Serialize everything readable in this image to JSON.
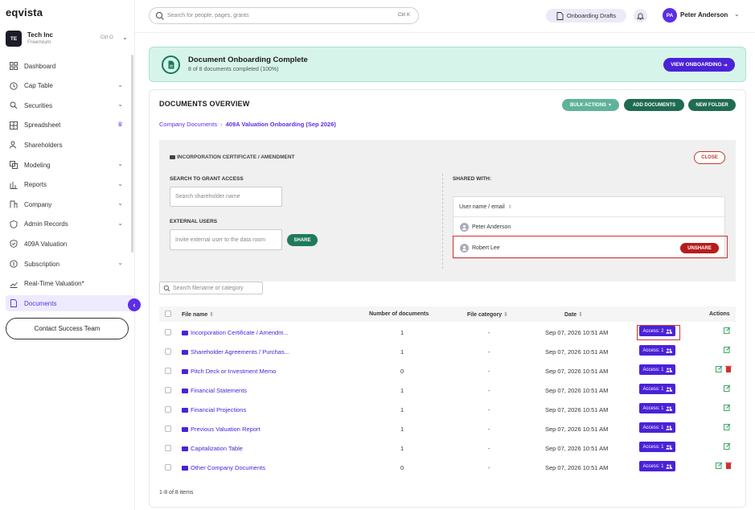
{
  "brand": {
    "logo": "eqvista",
    "accent": "#5b2ee8"
  },
  "org": {
    "initials": "TE",
    "name": "Tech Inc",
    "plan": "Freemium",
    "shortcut": "Ctrl O"
  },
  "sidebar": {
    "items": [
      {
        "label": "Dashboard",
        "icon": "dashboard-icon",
        "chevron": false
      },
      {
        "label": "Cap Table",
        "icon": "clock-icon",
        "chevron": true
      },
      {
        "label": "Securities",
        "icon": "securities-icon",
        "chevron": true
      },
      {
        "label": "Spreadsheet",
        "icon": "grid-icon",
        "chevron": false,
        "crown": true
      },
      {
        "label": "Shareholders",
        "icon": "users-icon",
        "chevron": false
      },
      {
        "label": "Modeling",
        "icon": "modeling-icon",
        "chevron": true
      },
      {
        "label": "Reports",
        "icon": "reports-icon",
        "chevron": true
      },
      {
        "label": "Company",
        "icon": "company-icon",
        "chevron": true
      },
      {
        "label": "Admin Records",
        "icon": "admin-icon",
        "chevron": true
      },
      {
        "label": "409A Valuation",
        "icon": "shield-icon",
        "chevron": false
      },
      {
        "label": "Subscription",
        "icon": "subscription-icon",
        "chevron": true
      },
      {
        "label": "Real-Time Valuation*",
        "icon": "chart-line-icon",
        "chevron": false
      },
      {
        "label": "Documents",
        "icon": "document-icon",
        "chevron": false,
        "active": true
      }
    ],
    "contact_label": "Contact Success Team"
  },
  "topbar": {
    "search_placeholder": "Search for people, pages, grants",
    "search_shortcut": "Ctrl K",
    "drafts_label": "Onboarding Drafts",
    "user_initials": "PA",
    "user_name": "Peter Anderson"
  },
  "banner": {
    "title": "Document Onboarding Complete",
    "subtitle": "8 of 8 documents completed (100%)",
    "button": "VIEW ONBOARDING"
  },
  "overview": {
    "title": "DOCUMENTS OVERVIEW",
    "bulk_actions": "BULK ACTIONS",
    "add_documents": "ADD DOCUMENTS",
    "new_folder": "NEW FOLDER",
    "breadcrumb_root": "Company Documents",
    "breadcrumb_current": "409A Valuation Onboarding (Sep 2026)"
  },
  "share_panel": {
    "folder_title": "INCORPORATION CERTIFICATE / AMENDMENT",
    "close": "CLOSE",
    "search_label": "SEARCH TO GRANT ACCESS",
    "search_placeholder": "Search shareholder name",
    "external_label": "EXTERNAL USERS",
    "external_placeholder": "Invite external user to the data room",
    "share_button": "SHARE",
    "shared_with_label": "SHARED WITH:",
    "column_header": "User name / email",
    "users": [
      "Peter Anderson",
      "Robert Lee"
    ],
    "unshare": "UNSHARE"
  },
  "table": {
    "filter_placeholder": "Search filename or category",
    "headers": {
      "file": "File name",
      "count": "Number of documents",
      "category": "File category",
      "date": "Date",
      "actions": "Actions"
    },
    "rows": [
      {
        "name": "Incorporation Certificate / Amendm...",
        "count": "1",
        "category": "-",
        "date": "Sep 07, 2026 10:51 AM",
        "access": "Access: 2",
        "delete": false
      },
      {
        "name": "Shareholder Agreements / Purchas...",
        "count": "1",
        "category": "-",
        "date": "Sep 07, 2026 10:51 AM",
        "access": "Access: 1",
        "delete": false
      },
      {
        "name": "Pitch Deck or Investment Memo",
        "count": "0",
        "category": "-",
        "date": "Sep 07, 2026 10:51 AM",
        "access": "Access: 1",
        "delete": true
      },
      {
        "name": "Financial Statements",
        "count": "1",
        "category": "-",
        "date": "Sep 07, 2026 10:51 AM",
        "access": "Access: 1",
        "delete": false
      },
      {
        "name": "Financial Projections",
        "count": "1",
        "category": "-",
        "date": "Sep 07, 2026 10:51 AM",
        "access": "Access: 1",
        "delete": false
      },
      {
        "name": "Previous Valuation Report",
        "count": "1",
        "category": "-",
        "date": "Sep 07, 2026 10:51 AM",
        "access": "Access: 1",
        "delete": false
      },
      {
        "name": "Capitalization Table",
        "count": "1",
        "category": "-",
        "date": "Sep 07, 2026 10:51 AM",
        "access": "Access: 1",
        "delete": false
      },
      {
        "name": "Other Company Documents",
        "count": "0",
        "category": "-",
        "date": "Sep 07, 2026 10:51 AM",
        "access": "Access: 1",
        "delete": true
      }
    ],
    "pagination": "1-8 of 8 items"
  }
}
